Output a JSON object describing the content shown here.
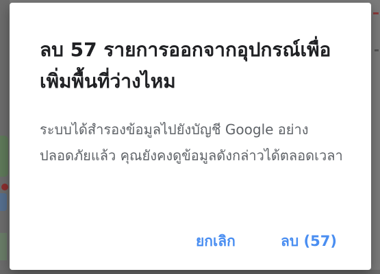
{
  "dialog": {
    "title": "ลบ 57 รายการออกจากอุปกรณ์เพื่อเพิ่มพื้นที่ว่างไหม",
    "body": "ระบบได้สำรองข้อมูลไปยังบัญชี Google อย่างปลอดภัยแล้ว คุณยังคงดูข้อมูลดังกล่าวได้ตลอดเวลา",
    "cancel_label": "ยกเลิก",
    "delete_label": "ลบ (57)"
  },
  "colors": {
    "accent": "#4a8ef1",
    "title": "#202124",
    "body": "#5f6368",
    "scrim": "#6f6f6f"
  }
}
